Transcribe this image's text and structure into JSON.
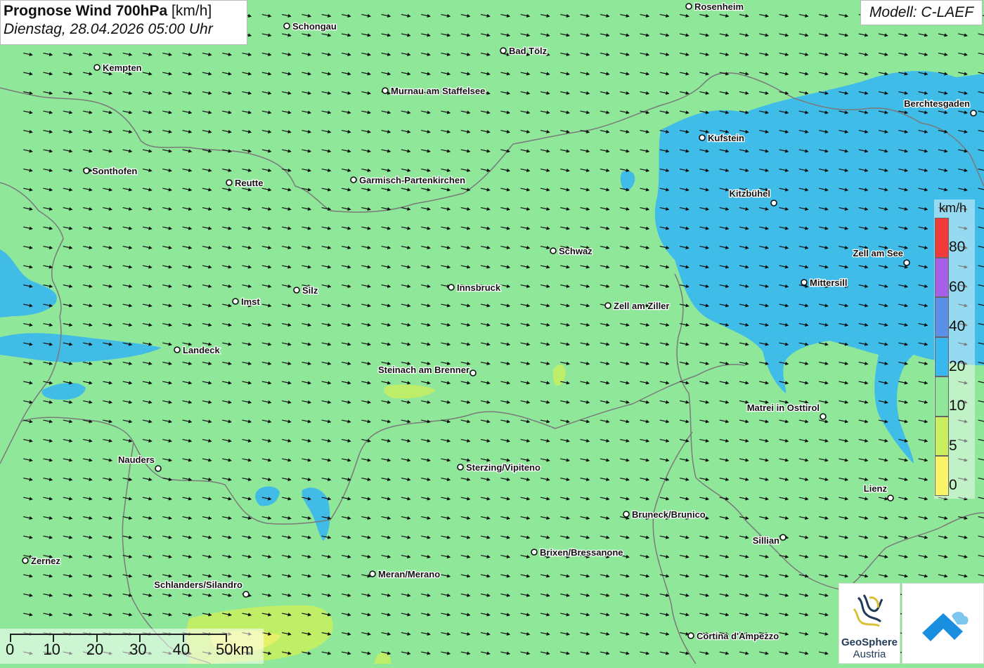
{
  "title": {
    "main": "Prognose Wind 700hPa",
    "unit": "[km/h]",
    "datetime": "Dienstag, 28.04.2026 05:00 Uhr"
  },
  "model": "Modell: C-LAEF",
  "legend": {
    "unit": "km/h",
    "labels": [
      "80",
      "60",
      "40",
      "20",
      "10",
      "5",
      "0"
    ],
    "colors": [
      "#f23a3a",
      "#a660e8",
      "#5b8fe8",
      "#39b7ef",
      "#8fe89a",
      "#c9ee5e",
      "#fbf36a"
    ]
  },
  "scalebar": {
    "labels": [
      "0",
      "10",
      "20",
      "30",
      "40",
      "50km"
    ]
  },
  "logos": {
    "geosphere_name": "GeoSphere",
    "geosphere_sub": "Austria"
  },
  "colors": {
    "base": "#8fe89a",
    "wind_20": "#39b7ef",
    "wind_5": "#c9ee5e",
    "wind_0": "#fbf36a",
    "border": "#7a7a7a",
    "arrow": "#111111"
  },
  "cities": [
    {
      "name": "Rosenheim",
      "icon": "town-icon"
    },
    {
      "name": "Schongau",
      "icon": "town-icon"
    },
    {
      "name": "Bad Tölz",
      "icon": "town-icon"
    },
    {
      "name": "Kempten",
      "icon": "city-icon"
    },
    {
      "name": "Murnau am Staffelsee",
      "icon": "town-icon"
    },
    {
      "name": "Berchtesgaden",
      "icon": "town-icon"
    },
    {
      "name": "Kufstein",
      "icon": "town-icon"
    },
    {
      "name": "Sonthofen",
      "icon": "town-icon"
    },
    {
      "name": "Reutte",
      "icon": "town-icon"
    },
    {
      "name": "Garmisch-Partenkirchen",
      "icon": "town-icon"
    },
    {
      "name": "Kitzbühel",
      "icon": "town-icon"
    },
    {
      "name": "Schwaz",
      "icon": "town-icon"
    },
    {
      "name": "Zell am See",
      "icon": "town-icon"
    },
    {
      "name": "Mittersill",
      "icon": "town-icon"
    },
    {
      "name": "Silz",
      "icon": "town-icon"
    },
    {
      "name": "Innsbruck",
      "icon": "city-icon"
    },
    {
      "name": "Imst",
      "icon": "town-icon"
    },
    {
      "name": "Zell am Ziller",
      "icon": "town-icon"
    },
    {
      "name": "Landeck",
      "icon": "town-icon"
    },
    {
      "name": "Steinach am Brenner",
      "icon": "town-icon"
    },
    {
      "name": "Matrei in Osttirol",
      "icon": "town-icon"
    },
    {
      "name": "Nauders",
      "icon": "town-icon"
    },
    {
      "name": "Sterzing/Vipiteno",
      "icon": "town-icon"
    },
    {
      "name": "Lienz",
      "icon": "town-icon"
    },
    {
      "name": "Bruneck/Brunico",
      "icon": "town-icon"
    },
    {
      "name": "Sillian",
      "icon": "town-icon"
    },
    {
      "name": "Brixen/Bressanone",
      "icon": "town-icon"
    },
    {
      "name": "Zernez",
      "icon": "town-icon"
    },
    {
      "name": "Meran/Merano",
      "icon": "town-icon"
    },
    {
      "name": "Schlanders/Silandro",
      "icon": "town-icon"
    },
    {
      "name": "Cortina d'Ampezzo",
      "icon": "town-icon"
    }
  ]
}
